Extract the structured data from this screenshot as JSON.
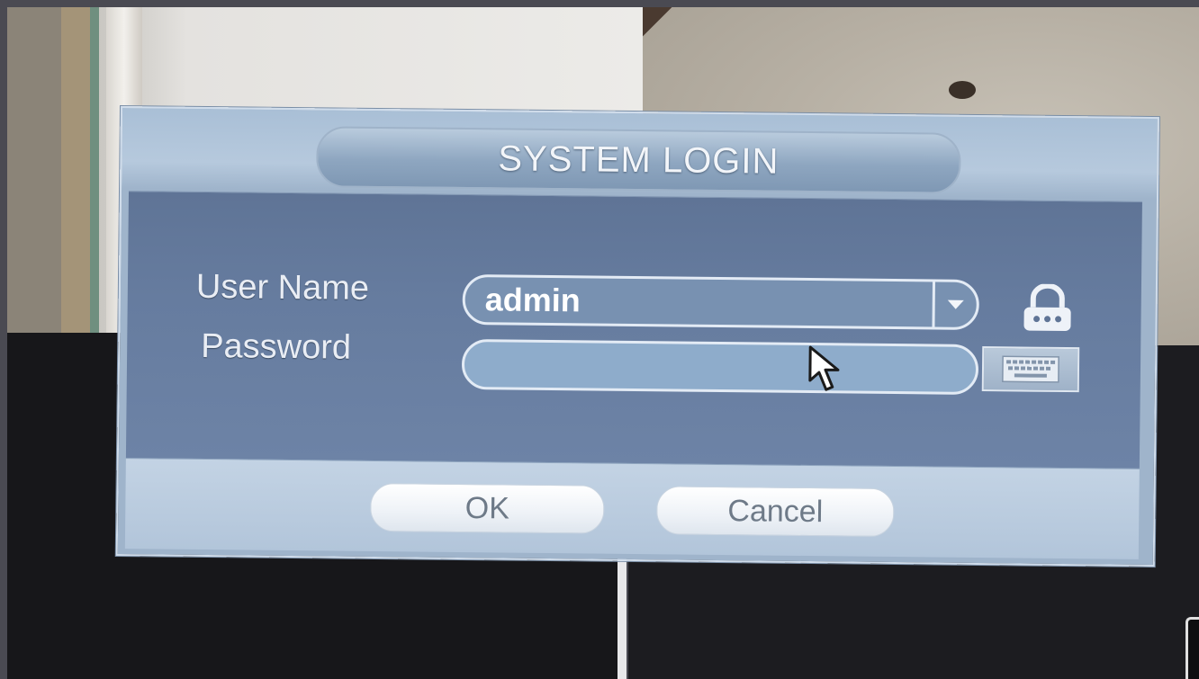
{
  "dialog": {
    "title": "SYSTEM LOGIN",
    "fields": {
      "username_label": "User Name",
      "username_value": "admin",
      "password_label": "Password",
      "password_value": ""
    },
    "icons": {
      "username_dropdown": "chevron-down-icon",
      "lock": "lock-icon",
      "keyboard": "keyboard-icon",
      "cursor": "mouse-pointer-icon"
    },
    "buttons": {
      "ok_label": "OK",
      "cancel_label": "Cancel"
    }
  },
  "colors": {
    "panel": "#667c9f",
    "frame": "#a9bfd6",
    "field": "#7891b1",
    "button_text": "#6e7a88"
  }
}
